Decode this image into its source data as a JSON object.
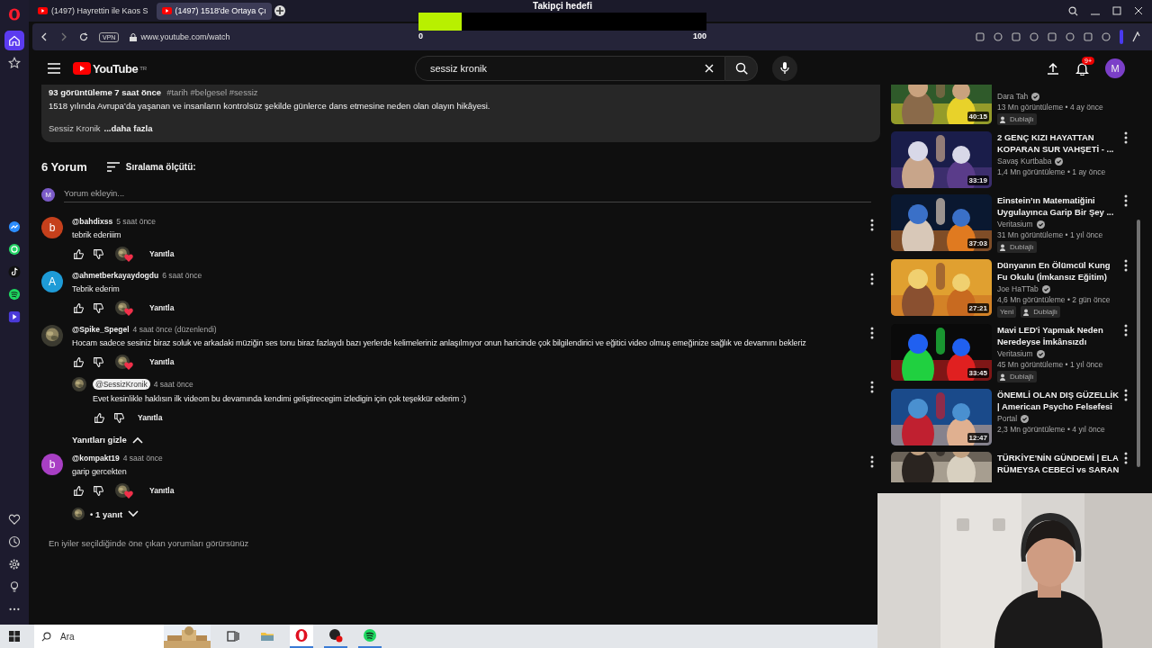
{
  "browser": {
    "tabs": [
      {
        "title": "(1497) Hayrettin ile Kaos S",
        "selected": false
      },
      {
        "title": "(1497) 1518'de Ortaya Çı",
        "selected": true
      }
    ],
    "vpn": "VPN",
    "url": "www.youtube.com/watch"
  },
  "opera_sidebar": {
    "top": [
      {
        "kind": "home",
        "selected": true
      },
      {
        "kind": "star",
        "selected": false
      }
    ],
    "apps": [
      {
        "kind": "messenger",
        "selected": false
      },
      {
        "kind": "whatsapp",
        "selected": false
      },
      {
        "kind": "tiktok",
        "selected": false
      },
      {
        "kind": "spotify",
        "selected": false
      },
      {
        "kind": "player",
        "selected": false
      }
    ],
    "bottom": [
      {
        "kind": "heart",
        "selected": false
      },
      {
        "kind": "clock",
        "selected": false
      },
      {
        "kind": "gear",
        "selected": false
      },
      {
        "kind": "bulb",
        "selected": false
      },
      {
        "kind": "more",
        "selected": false
      }
    ]
  },
  "goal": {
    "title": "Takipçi hedefi",
    "level": 0.15,
    "min": "0",
    "max": "100"
  },
  "youtube": {
    "logo": "YouTube",
    "region": "TR",
    "search": "sessiz kronik",
    "notifications": "9+",
    "avatar": "M"
  },
  "description": {
    "meta": "93 görüntüleme  7 saat önce",
    "tags": "#tarih #belgesel #sessiz",
    "text": "1518 yılında Avrupa’da yaşanan ve insanların kontrolsüz şekilde günlerce dans etmesine neden olan olayın hikâyesi.",
    "channel": "Sessiz Kronik",
    "more": "...daha fazla"
  },
  "comments": {
    "count": "6 Yorum",
    "sort": "Sıralama ölçütü:",
    "add": {
      "avatar": "M",
      "placeholder": "Yorum ekleyin..."
    },
    "items": [
      {
        "author": "@bahdixss",
        "owner": false,
        "time": "5 saat önce",
        "text": "tebrik ederiiim",
        "avatar": {
          "kind": "letter",
          "letter": "b",
          "color": "#c5401c"
        },
        "hearted": true,
        "reply": "Yanıtla"
      },
      {
        "author": "@ahmetberkayaydogdu",
        "owner": false,
        "time": "6 saat önce",
        "text": "Tebrik ederim",
        "avatar": {
          "kind": "letter",
          "letter": "A",
          "color": "#1e9bd7"
        },
        "hearted": true,
        "reply": "Yanıtla"
      },
      {
        "author": "@Spike_Spegel",
        "owner": false,
        "time": "4 saat önce (düzenlendi)",
        "text": "Hocam sadece sesiniz biraz soluk ve arkadaki müziğin ses tonu biraz fazlaydı bazı yerlerde kelimeleriniz anlaşılmıyor onun haricinde çok bilgilendirici ve eğitici video olmuş emeğinize sağlık ve devamını bekleriz",
        "hearted": true,
        "reply": "Yanıtla",
        "replies": {
          "label": "Yanıtları gizle",
          "expanded": true,
          "children": [
            {
              "author": "@SessizKronik",
              "owner": true,
              "time": "4 saat önce",
              "text": "Evet kesinlikle haklısın ilk videom bu devamında kendimi geliştirecegim izledigin için çok teşekkür ederim :)",
              "reply": "Yanıtla"
            }
          ]
        }
      },
      {
        "author": "@kompakt19",
        "owner": false,
        "time": "4 saat önce",
        "text": "garip gercekten",
        "avatar": {
          "kind": "letter",
          "letter": "b",
          "color": "#a83fc4"
        },
        "hearted": true,
        "reply": "Yanıtla",
        "replies": {
          "label": "• 1 yanıt",
          "expanded": false
        }
      }
    ],
    "note": "En iyiler seçildiğinde öne çıkan yorumları görürsünüz"
  },
  "videos": [
    {
      "channel": "Dara Tah",
      "verified": true,
      "views": "13 Mn görüntüleme • 4 ay önce",
      "badges": [
        "Dublajlı"
      ],
      "duration": "40:15"
    },
    {
      "title": "2 GENÇ KIZI HAYATTAN KOPARAN SUR VAHŞETİ - ...",
      "channel": "Savaş Kurtbaba",
      "verified": true,
      "views": "1,4 Mn görüntüleme • 1 ay önce",
      "duration": "33:19"
    },
    {
      "title": "Einstein’ın Matematiğini Uygulayınca Garip Bir Şey ...",
      "channel": "Veritasium",
      "verified": true,
      "views": "31 Mn görüntüleme • 1 yıl önce",
      "badges": [
        "Dublajlı"
      ],
      "duration": "37:03"
    },
    {
      "title": "Dünyanın En Ölümcül Kung Fu Okulu (İmkansız Eğitim)",
      "channel": "Joe HaTTab",
      "verified": true,
      "views": "4,6 Mn görüntüleme • 2 gün önce",
      "badges": [
        "Yeni",
        "Dublajlı"
      ],
      "duration": "27:21"
    },
    {
      "title": "Mavi LED'i Yapmak Neden Neredeyse İmkânsızdı",
      "channel": "Veritasium",
      "verified": true,
      "views": "45 Mn görüntüleme • 1 yıl önce",
      "badges": [
        "Dublajlı"
      ],
      "duration": "33:45"
    },
    {
      "title": "ÖNEMLİ OLAN DIŞ GÜZELLİK | American Psycho Felsefesi",
      "channel": "Portal",
      "verified": true,
      "views": "2,3 Mn görüntüleme • 4 yıl önce",
      "duration": "12:47"
    },
    {
      "title": "TÜRKİYE'NİN GÜNDEMİ | ELA RÜMEYSA CEBECİ vs SARAN"
    }
  ],
  "taskbar": {
    "search": "Ara",
    "apps": [
      {
        "kind": "taskview",
        "selected": false,
        "running": false
      },
      {
        "kind": "folder",
        "selected": false,
        "running": false
      },
      {
        "kind": "opera",
        "selected": true,
        "running": true
      },
      {
        "kind": "app",
        "selected": false,
        "running": true
      },
      {
        "kind": "spotify",
        "selected": false,
        "running": true
      }
    ]
  }
}
